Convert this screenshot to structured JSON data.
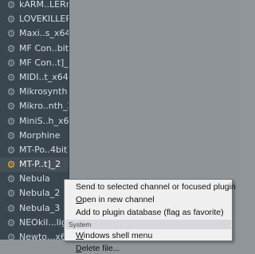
{
  "browser": {
    "items": [
      {
        "label": "kARM..LERr1",
        "icon": "gear-icon"
      },
      {
        "label": "LOVEKILLER",
        "icon": "gear-icon"
      },
      {
        "label": "Maxi..s_x64",
        "icon": "gear-icon"
      },
      {
        "label": "MF Con..bit]",
        "icon": "gear-icon"
      },
      {
        "label": "MF Con..t]_2",
        "icon": "gear-icon"
      },
      {
        "label": "MIDI..t_x64",
        "icon": "gear-icon"
      },
      {
        "label": "Mikrosynth",
        "icon": "gear-icon"
      },
      {
        "label": "Mikro..nth_2",
        "icon": "gear-icon"
      },
      {
        "label": "MiniS..h_x64",
        "icon": "gear-icon"
      },
      {
        "label": "Morphine",
        "icon": "gear-icon"
      },
      {
        "label": "MT-Po..4bit]",
        "icon": "gear-icon"
      },
      {
        "label": "MT-P..t]_2",
        "icon": "gear-icon"
      },
      {
        "label": "Nebula",
        "icon": "gear-icon"
      },
      {
        "label": "Nebula_2",
        "icon": "gear-icon"
      },
      {
        "label": "Nebula_3",
        "icon": "gear-icon"
      },
      {
        "label": "NEOkil...ligh",
        "icon": "gear-icon"
      },
      {
        "label": "Newto...x64",
        "icon": "gear-icon"
      }
    ],
    "selected_index": 11
  },
  "context_menu": {
    "send": "Send to selected channel or focused plugin",
    "open_prefix": "O",
    "open_rest": "pen in new channel",
    "add": "Add to plugin database (flag as favorite)",
    "section_system": "System",
    "windows_prefix": "W",
    "windows_rest": "indows shell menu",
    "delete_prefix": "D",
    "delete_rest": "elete file..."
  },
  "colors": {
    "browser_bg": "#3a464f",
    "workspace_bg": "#8e9498",
    "selected_icon": "#f0b531",
    "menu_bg": "#f0f0f0"
  }
}
